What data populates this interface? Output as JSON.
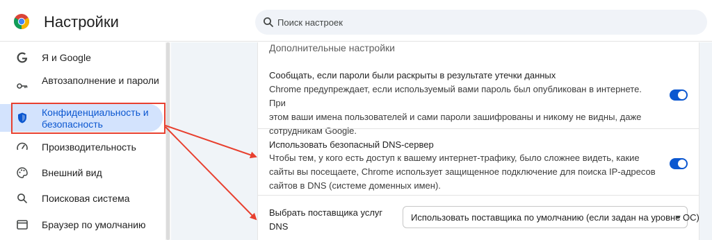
{
  "header": {
    "title": "Настройки",
    "search_placeholder": "Поиск настроек",
    "logo_icon": "chrome-logo-icon"
  },
  "sidebar": {
    "items": [
      {
        "label": "Я и Google",
        "icon": "google-g-icon"
      },
      {
        "label": "Автозаполнение и пароли",
        "icon": "key-icon"
      },
      {
        "label": "Конфиденциальность и безопасность",
        "icon": "shield-icon",
        "active": true
      },
      {
        "label": "Производительность",
        "icon": "speedometer-icon"
      },
      {
        "label": "Внешний вид",
        "icon": "palette-icon"
      },
      {
        "label": "Поисковая система",
        "icon": "search-icon"
      },
      {
        "label": "Браузер по умолчанию",
        "icon": "browser-window-icon"
      }
    ]
  },
  "main": {
    "section_title": "Дополнительные настройки",
    "rows": [
      {
        "title": "Сообщать, если пароли были раскрыты в результате утечки данных",
        "description_lines": [
          "Chrome предупреждает, если используемый вами пароль был опубликован в интернете. При",
          "этом ваши имена пользователей и сами пароли зашифрованы и никому не видны, даже",
          "сотрудникам Google."
        ],
        "toggle_on": true
      },
      {
        "title": "Использовать безопасный DNS-сервер",
        "description_lines": [
          "Чтобы тем, у кого есть доступ к вашему интернет-трафику, было сложнее видеть, какие",
          "сайты вы посещаете, Chrome использует защищенное подключение для поиска IP-адресов",
          "сайтов в DNS (системе доменных имен)."
        ],
        "toggle_on": true
      }
    ],
    "dns_provider": {
      "label_lines": [
        "Выбрать поставщика услуг",
        "DNS"
      ],
      "selected": "Использовать поставщика по умолчанию (если задан на уровне ОС)"
    }
  },
  "colors": {
    "accent": "#0b57d0",
    "active_nav_bg": "#d3e3fd",
    "annotation_red": "#e8402f",
    "main_bg": "#f0f4f8"
  }
}
